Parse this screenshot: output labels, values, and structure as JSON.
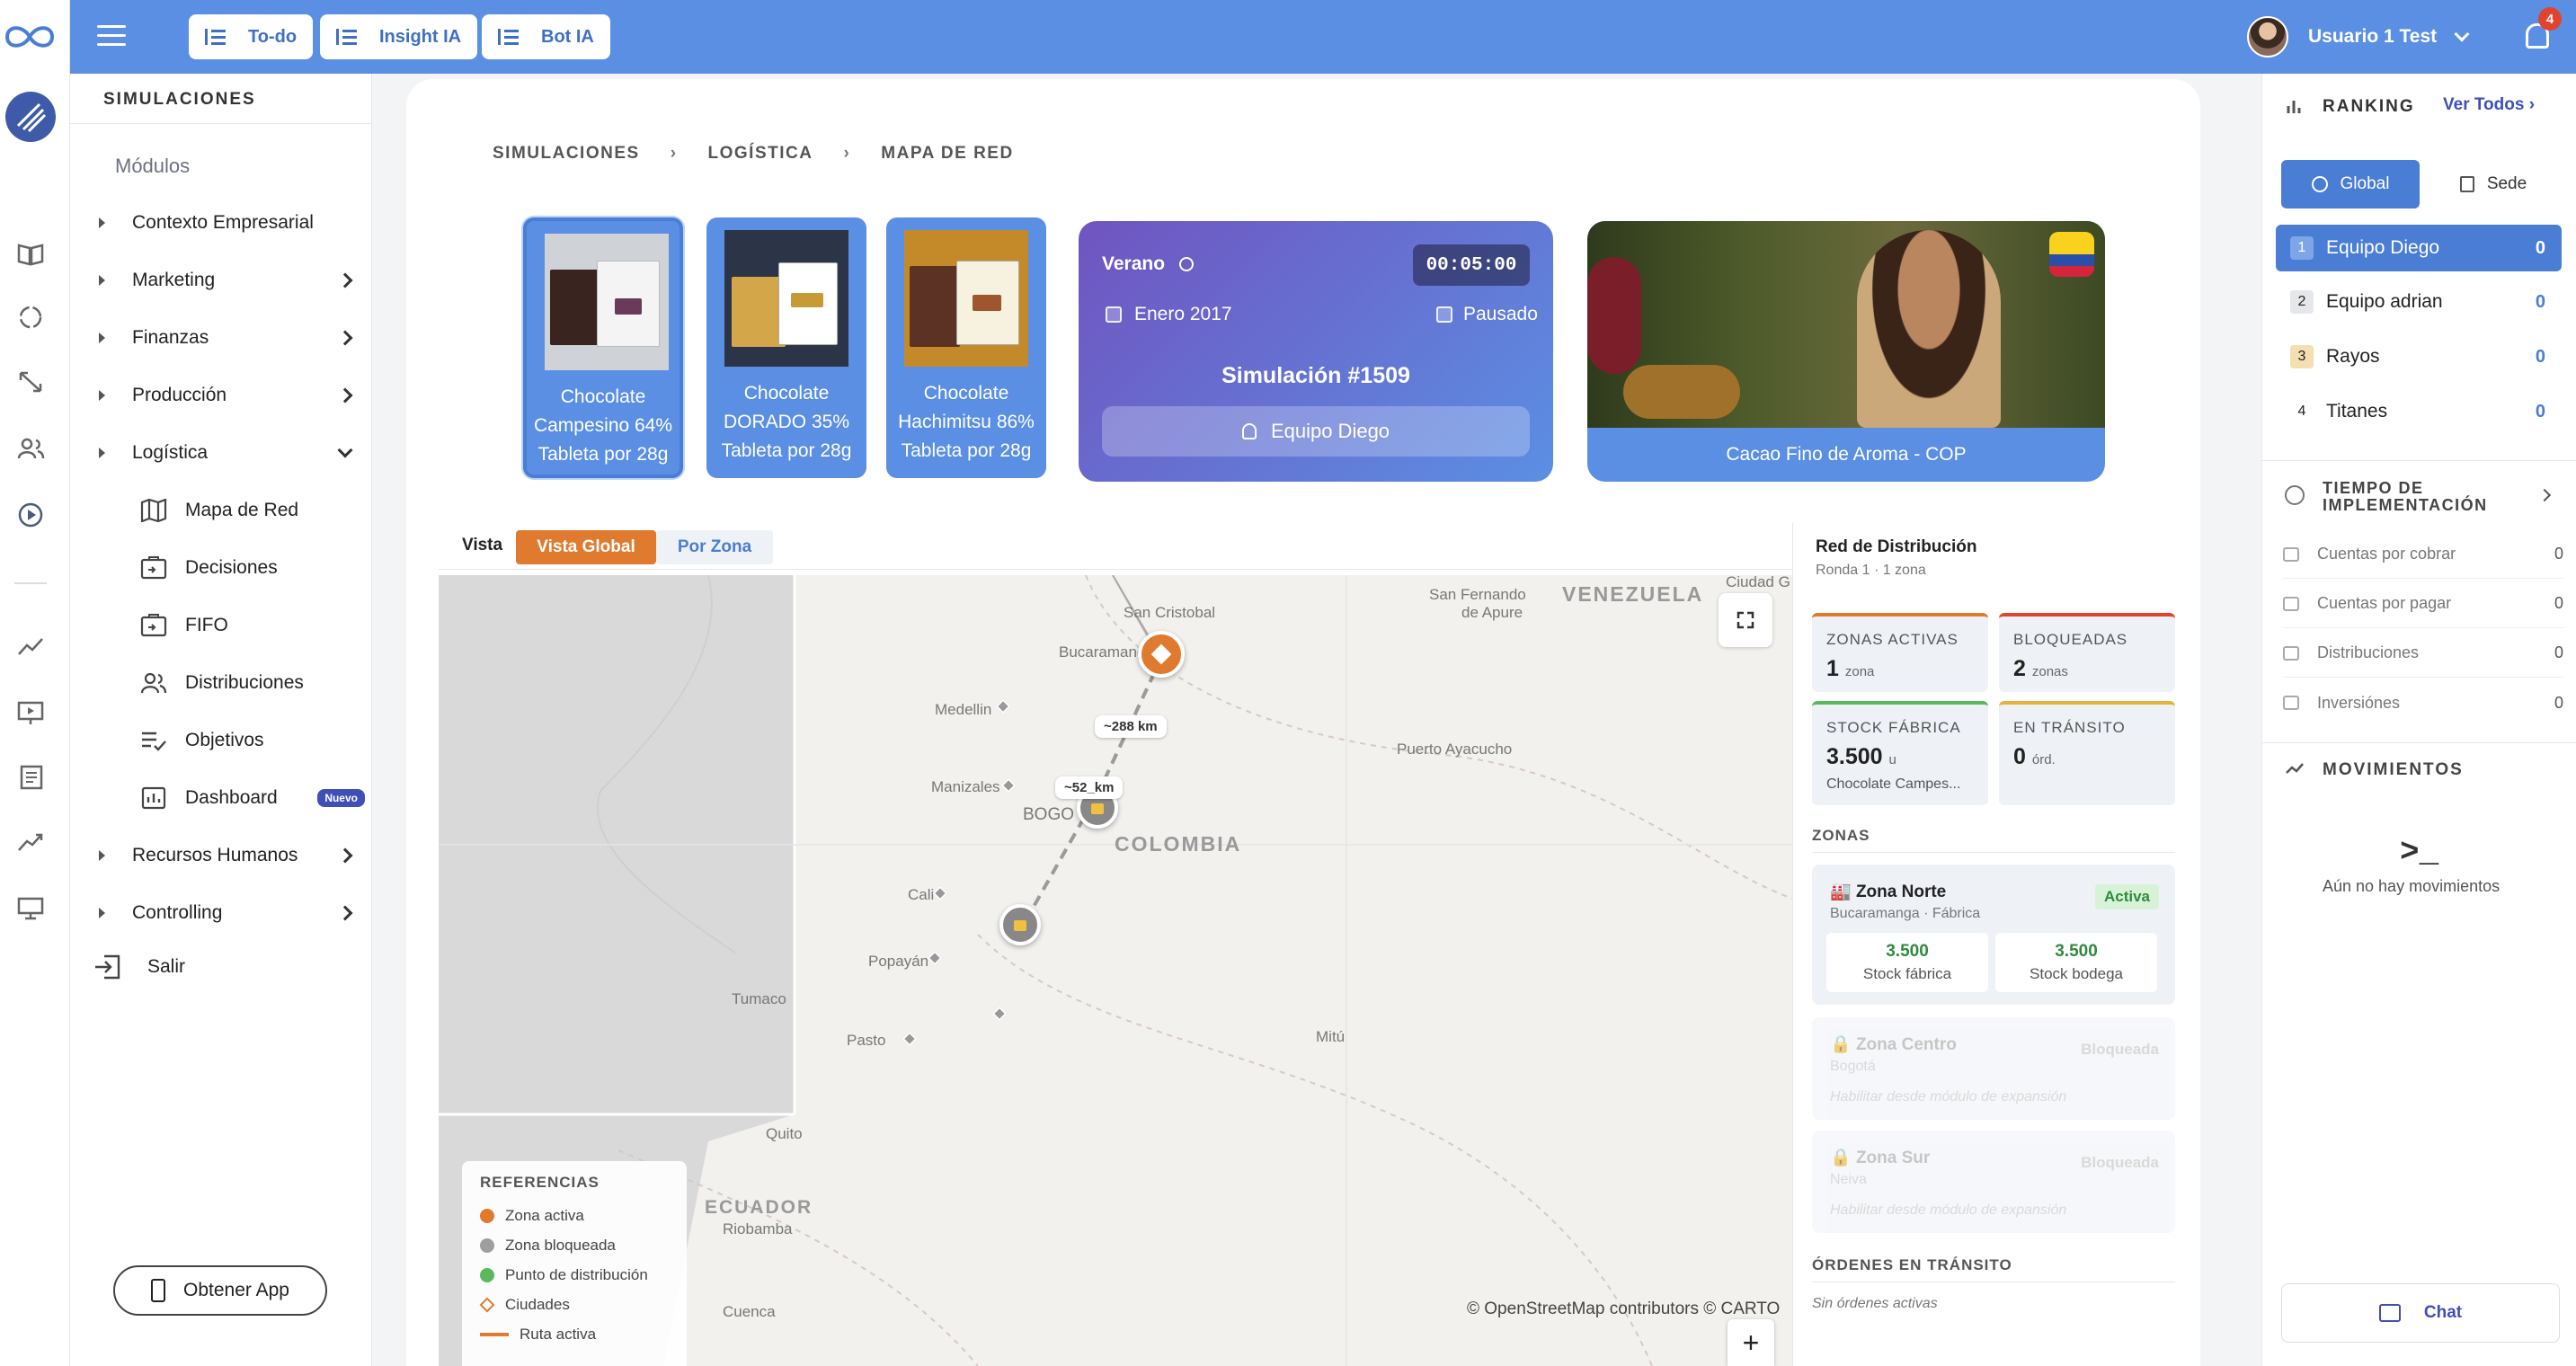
{
  "topbar": {
    "buttons": [
      "To-do",
      "Insight IA",
      "Bot IA"
    ],
    "user_name": "Usuario 1 Test",
    "notifications": "4"
  },
  "sidebar": {
    "header": "SIMULACIONES",
    "modules_label": "Módulos",
    "items": [
      {
        "label": "Contexto Empresarial"
      },
      {
        "label": "Marketing"
      },
      {
        "label": "Finanzas"
      },
      {
        "label": "Producción"
      },
      {
        "label": "Logística"
      }
    ],
    "subitems": [
      {
        "label": "Mapa de Red",
        "icon": "map-icon"
      },
      {
        "label": "Decisiones",
        "icon": "decisions-icon"
      },
      {
        "label": "FIFO",
        "icon": "fifo-icon"
      },
      {
        "label": "Distribuciones",
        "icon": "people-icon"
      },
      {
        "label": "Objetivos",
        "icon": "checklist-icon"
      },
      {
        "label": "Dashboard",
        "icon": "dashboard-icon",
        "badge": "Nuevo"
      }
    ],
    "items_after": [
      {
        "label": "Recursos Humanos"
      },
      {
        "label": "Controlling"
      }
    ],
    "exit_label": "Salir",
    "get_app_label": "Obtener App"
  },
  "breadcrumb": [
    "SIMULACIONES",
    "LOGÍSTICA",
    "MAPA DE RED"
  ],
  "products": [
    {
      "line1": "Chocolate",
      "line2": "Campesino 64%",
      "line3": "Tableta por 28g"
    },
    {
      "line1": "Chocolate",
      "line2": "DORADO 35%",
      "line3": "Tableta por 28g"
    },
    {
      "line1": "Chocolate",
      "line2": "Hachimitsu 86%",
      "line3": "Tableta por 28g"
    }
  ],
  "simulation": {
    "season": "Verano",
    "timer": "00:05:00",
    "date": "Enero 2017",
    "status": "Pausado",
    "title": "Simulación #1509",
    "team": "Equipo Diego"
  },
  "photo_card": {
    "caption": "Cacao Fino de Aroma - COP"
  },
  "view": {
    "label": "Vista",
    "options": [
      "Vista Global",
      "Por Zona"
    ],
    "selected": "Vista Global"
  },
  "map": {
    "country": "COLOMBIA",
    "venezuela": "VENEZUELA",
    "ecuador": "ECUADOR",
    "cities": [
      "San Cristobal",
      "Bucaramanga",
      "Medellin",
      "Manizales",
      "BOGO",
      "Cali",
      "Popayán",
      "Tumaco",
      "Pasto",
      "Quito",
      "Riobamba",
      "Cuenca",
      "Mitú",
      "Puerto Ayacucho",
      "San Fernando",
      "de Apure",
      "Ciudad G"
    ],
    "distances": [
      "~288 km",
      "~52_km"
    ],
    "legend_title": "REFERENCIAS",
    "legend": [
      {
        "label": "Zona activa",
        "color": "#e07a2e"
      },
      {
        "label": "Zona bloqueada",
        "color": "#9e9e9e"
      },
      {
        "label": "Punto de distribución",
        "color": "#5cb85c"
      },
      {
        "label": "Ciudades",
        "color": "#e07a2e"
      },
      {
        "label": "Ruta activa",
        "color": "#e07a2e"
      }
    ],
    "attribution": "© OpenStreetMap contributors © CARTO",
    "zoom_in": "+"
  },
  "network": {
    "title": "Red de Distribución",
    "subtitle": "Ronda 1 · 1 zona",
    "stats": [
      {
        "title": "ZONAS ACTIVAS",
        "value": "1",
        "unit": "zona",
        "color": "#e07a2e"
      },
      {
        "title": "BLOQUEADAS",
        "value": "2",
        "unit": "zonas",
        "color": "#e0442f"
      },
      {
        "title": "STOCK FÁBRICA",
        "value": "3.500",
        "unit": "u",
        "sub": "Chocolate Campes...",
        "color": "#5cb85c"
      },
      {
        "title": "EN TRÁNSITO",
        "value": "0",
        "unit": "órd.",
        "color": "#e8b23a"
      }
    ],
    "zones_label": "ZONAS",
    "zones": [
      {
        "name": "Zona Norte",
        "city": "Bucaramanga · Fábrica",
        "status": "Activa",
        "stock_factory": "3.500",
        "stock_factory_label": "Stock fábrica",
        "stock_warehouse": "3.500",
        "stock_warehouse_label": "Stock bodega"
      },
      {
        "name": "Zona Centro",
        "city": "Bogotá",
        "status": "Bloqueada",
        "note": "Habilitar desde módulo de expansión"
      },
      {
        "name": "Zona Sur",
        "city": "Neiva",
        "status": "Bloqueada",
        "note": "Habilitar desde módulo de expansión"
      }
    ],
    "transit_label": "ÓRDENES EN TRÁNSITO",
    "transit_empty": "Sin órdenes activas"
  },
  "ranking": {
    "title": "RANKING",
    "see_all": "Ver Todos",
    "tabs": [
      "Global",
      "Sede"
    ],
    "rows": [
      {
        "pos": "1",
        "name": "Equipo Diego",
        "score": "0"
      },
      {
        "pos": "2",
        "name": "Equipo adrian",
        "score": "0"
      },
      {
        "pos": "3",
        "name": "Rayos",
        "score": "0"
      },
      {
        "pos": "4",
        "name": "Titanes",
        "score": "0"
      }
    ],
    "impl_title": "TIEMPO DE IMPLEMENTACIÓN",
    "impl_rows": [
      {
        "label": "Cuentas por cobrar",
        "value": "0"
      },
      {
        "label": "Cuentas por pagar",
        "value": "0"
      },
      {
        "label": "Distribuciones",
        "value": "0"
      },
      {
        "label": "Inversiónes",
        "value": "0"
      }
    ],
    "moves_title": "MOVIMIENTOS",
    "moves_empty": "Aún no hay movimientos",
    "chat": "Chat"
  }
}
